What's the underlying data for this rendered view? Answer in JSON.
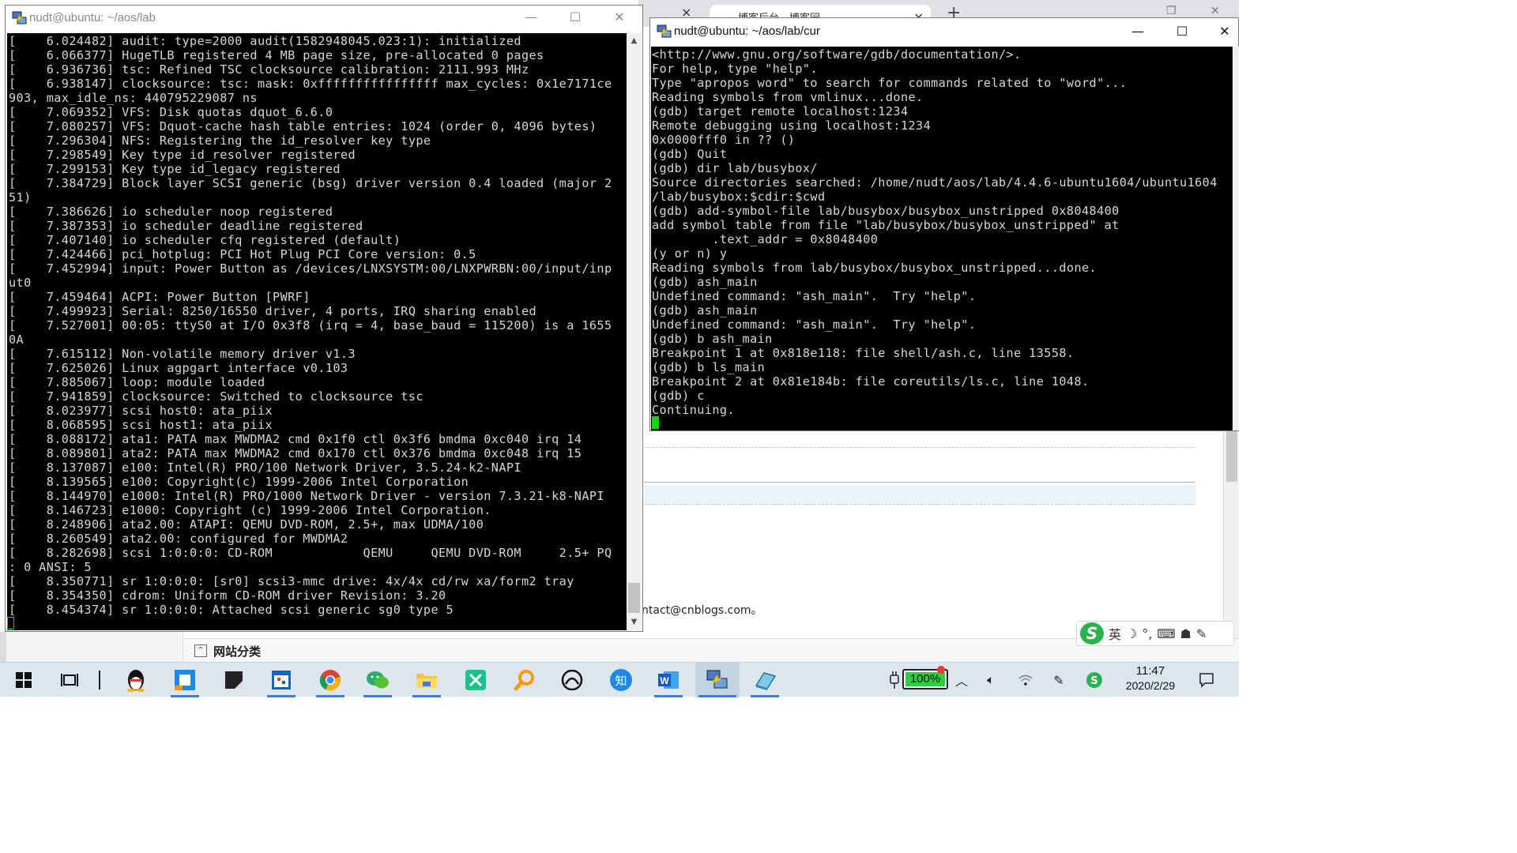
{
  "background_browser": {
    "tab_title": "博客后台 - 博客园",
    "tab_close": "×",
    "new_tab": "+",
    "contact_text": "ntact@cnblogs.com。",
    "category_label": "网站分类"
  },
  "ime_toolbar": {
    "logo": "S",
    "lang": "英",
    "items": [
      "☽",
      "°,",
      "⌨",
      "☗",
      "✎"
    ]
  },
  "putty_left": {
    "title": "nudt@ubuntu: ~/aos/lab",
    "minimize": "—",
    "maximize": "☐",
    "close": "✕",
    "lines": [
      "[    6.024482] audit: type=2000 audit(1582948045.023:1): initialized",
      "[    6.066377] HugeTLB registered 4 MB page size, pre-allocated 0 pages",
      "[    6.936736] tsc: Refined TSC clocksource calibration: 2111.993 MHz",
      "[    6.938147] clocksource: tsc: mask: 0xffffffffffffffff max_cycles: 0x1e7171ce",
      "903, max_idle_ns: 440795229087 ns",
      "[    7.069352] VFS: Disk quotas dquot_6.6.0",
      "[    7.080257] VFS: Dquot-cache hash table entries: 1024 (order 0, 4096 bytes)",
      "[    7.296304] NFS: Registering the id_resolver key type",
      "[    7.298549] Key type id_resolver registered",
      "[    7.299153] Key type id_legacy registered",
      "[    7.384729] Block layer SCSI generic (bsg) driver version 0.4 loaded (major 2",
      "51)",
      "[    7.386626] io scheduler noop registered",
      "[    7.387353] io scheduler deadline registered",
      "[    7.407140] io scheduler cfq registered (default)",
      "[    7.424466] pci_hotplug: PCI Hot Plug PCI Core version: 0.5",
      "[    7.452994] input: Power Button as /devices/LNXSYSTM:00/LNXPWRBN:00/input/inp",
      "ut0",
      "[    7.459464] ACPI: Power Button [PWRF]",
      "[    7.499923] Serial: 8250/16550 driver, 4 ports, IRQ sharing enabled",
      "[    7.527001] 00:05: ttyS0 at I/O 0x3f8 (irq = 4, base_baud = 115200) is a 1655",
      "0A",
      "[    7.615112] Non-volatile memory driver v1.3",
      "[    7.625026] Linux agpgart interface v0.103",
      "[    7.885067] loop: module loaded",
      "[    7.941859] clocksource: Switched to clocksource tsc",
      "[    8.023977] scsi host0: ata_piix",
      "[    8.068595] scsi host1: ata_piix",
      "[    8.088172] ata1: PATA max MWDMA2 cmd 0x1f0 ctl 0x3f6 bmdma 0xc040 irq 14",
      "[    8.089801] ata2: PATA max MWDMA2 cmd 0x170 ctl 0x376 bmdma 0xc048 irq 15",
      "[    8.137087] e100: Intel(R) PRO/100 Network Driver, 3.5.24-k2-NAPI",
      "[    8.139565] e100: Copyright(c) 1999-2006 Intel Corporation",
      "[    8.144970] e1000: Intel(R) PRO/1000 Network Driver - version 7.3.21-k8-NAPI",
      "[    8.146723] e1000: Copyright (c) 1999-2006 Intel Corporation.",
      "[    8.248906] ata2.00: ATAPI: QEMU DVD-ROM, 2.5+, max UDMA/100",
      "[    8.260549] ata2.00: configured for MWDMA2",
      "[    8.282698] scsi 1:0:0:0: CD-ROM            QEMU     QEMU DVD-ROM     2.5+ PQ",
      ": 0 ANSI: 5",
      "[    8.350771] sr 1:0:0:0: [sr0] scsi3-mmc drive: 4x/4x cd/rw xa/form2 tray",
      "[    8.354350] cdrom: Uniform CD-ROM driver Revision: 3.20",
      "[    8.454374] sr 1:0:0:0: Attached scsi generic sg0 type 5"
    ]
  },
  "putty_right": {
    "title": "nudt@ubuntu: ~/aos/lab/cur",
    "minimize": "—",
    "maximize": "☐",
    "close": "✕",
    "lines": [
      "<http://www.gnu.org/software/gdb/documentation/>.",
      "For help, type \"help\".",
      "Type \"apropos word\" to search for commands related to \"word\"...",
      "Reading symbols from vmlinux...done.",
      "(gdb) target remote localhost:1234",
      "Remote debugging using localhost:1234",
      "0x0000fff0 in ?? ()",
      "(gdb) Quit",
      "(gdb) dir lab/busybox/",
      "Source directories searched: /home/nudt/aos/lab/4.4.6-ubuntu1604/ubuntu1604",
      "/lab/busybox:$cdir:$cwd",
      "(gdb) add-symbol-file lab/busybox/busybox_unstripped 0x8048400",
      "add symbol table from file \"lab/busybox/busybox_unstripped\" at",
      "        .text_addr = 0x8048400",
      "(y or n) y",
      "Reading symbols from lab/busybox/busybox_unstripped...done.",
      "(gdb) ash_main",
      "Undefined command: \"ash_main\".  Try \"help\".",
      "(gdb) ash_main",
      "Undefined command: \"ash_main\".  Try \"help\".",
      "(gdb) b ash_main",
      "Breakpoint 1 at 0x818e118: file shell/ash.c, line 13558.",
      "(gdb) b ls_main",
      "Breakpoint 2 at 0x81e184b: file coreutils/ls.c, line 1048.",
      "(gdb) c",
      "Continuing."
    ]
  },
  "taskbar": {
    "apps": [
      {
        "name": "start-button",
        "icon": "windows-logo-icon"
      },
      {
        "name": "task-view-button",
        "icon": "task-view-icon"
      },
      {
        "name": "qq-button",
        "icon": "penguin-icon"
      },
      {
        "name": "app-blue-square-button",
        "icon": "blue-square-icon"
      },
      {
        "name": "app-note-button",
        "icon": "note-icon"
      },
      {
        "name": "app-calendar-button",
        "icon": "calendar-icon"
      },
      {
        "name": "chrome-button",
        "icon": "chrome-icon"
      },
      {
        "name": "wechat-button",
        "icon": "wechat-icon"
      },
      {
        "name": "file-explorer-button",
        "icon": "folder-icon"
      },
      {
        "name": "app-x-button",
        "icon": "x-logo-icon"
      },
      {
        "name": "search-app-button",
        "icon": "magnifier-icon"
      },
      {
        "name": "app-console-button",
        "icon": "gamepad-icon"
      },
      {
        "name": "zhihu-button",
        "icon": "zhihu-icon"
      },
      {
        "name": "word-button",
        "icon": "word-icon"
      },
      {
        "name": "putty-button",
        "icon": "putty-icon"
      },
      {
        "name": "app-eraser-button",
        "icon": "eraser-icon"
      }
    ],
    "battery_percent": "100%",
    "battery_level": 1.0,
    "time": "11:47",
    "date": "2020/2/29"
  },
  "colors": {
    "terminal_bg": "#000000",
    "terminal_fg": "#d6d6d6",
    "cursor": "#00e000",
    "taskbar": "#dde6ee"
  }
}
